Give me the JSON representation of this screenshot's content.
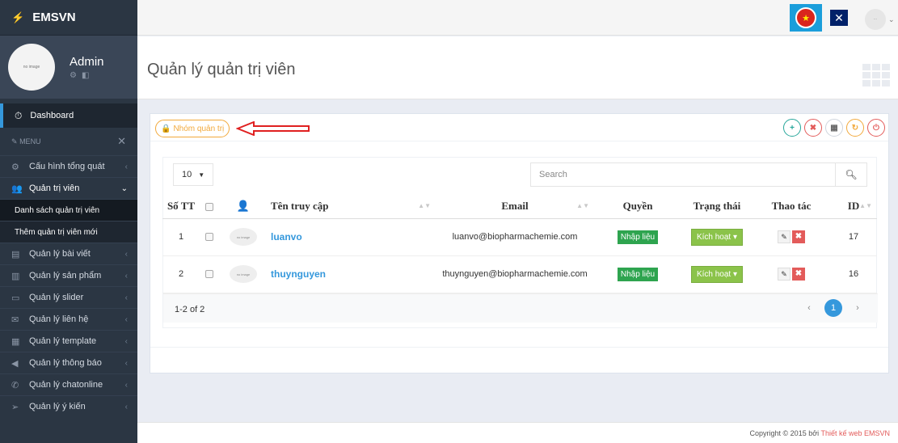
{
  "brand": {
    "name": "EMSVN"
  },
  "profile": {
    "name": "Admin",
    "avatar_text": "no image"
  },
  "sidebar": {
    "dashboard": "Dashboard",
    "menu_label": "MENU",
    "items": [
      {
        "label": "Cấu hình tổng quát",
        "icon": "gears-icon"
      },
      {
        "label": "Quản trị viên",
        "icon": "users-icon"
      },
      {
        "label": "Quản lý bài viết",
        "icon": "file-icon"
      },
      {
        "label": "Quản lý sản phẩm",
        "icon": "book-icon"
      },
      {
        "label": "Quản lý slider",
        "icon": "monitor-icon"
      },
      {
        "label": "Quản lý liên hệ",
        "icon": "envelope-icon"
      },
      {
        "label": "Quản lý template",
        "icon": "table-icon"
      },
      {
        "label": "Quản lý thông báo",
        "icon": "bullhorn-icon"
      },
      {
        "label": "Quản lý chatonline",
        "icon": "phone-icon"
      },
      {
        "label": "Quản lý ý kiến",
        "icon": "send-icon"
      }
    ],
    "subitems": [
      "Danh sách quản trị viên",
      "Thêm quản trị viên mới"
    ]
  },
  "page": {
    "title": "Quản lý quản trị viên"
  },
  "portlet": {
    "group_button": "Nhóm quản trị"
  },
  "table": {
    "page_length": "10",
    "search_placeholder": "Search",
    "columns": [
      "Số TT",
      "",
      "",
      "Tên truy cập",
      "Email",
      "Quyền",
      "Trạng thái",
      "Thao tác",
      "ID"
    ],
    "rows": [
      {
        "stt": "1",
        "avatar": "no image",
        "username": "luanvo",
        "email": "luanvo@biopharmachemie.com",
        "role": "Nhập liệu",
        "status": "Kích hoạt",
        "id": "17"
      },
      {
        "stt": "2",
        "avatar": "no image",
        "username": "thuynguyen",
        "email": "thuynguyen@biopharmachemie.com",
        "role": "Nhập liệu",
        "status": "Kích hoạt",
        "id": "16"
      }
    ],
    "info": "1-2 of 2",
    "current_page": "1"
  },
  "footer": {
    "prefix": "Copyright © 2015 bởi",
    "link": "Thiết kế web EMSVN"
  },
  "colors": {
    "sidebar": "#2b3643",
    "accent": "#3598dc",
    "warning": "#f2a93b",
    "danger": "#e35b5a",
    "success": "#2ea44f"
  }
}
